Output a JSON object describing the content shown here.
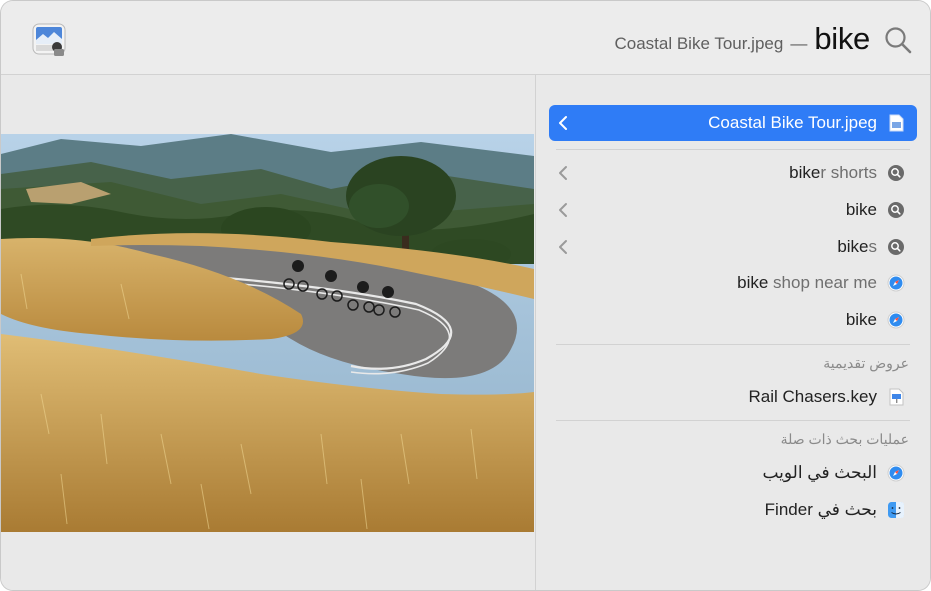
{
  "header": {
    "selected_title": "Coastal Bike Tour.jpeg",
    "dash": "—",
    "query": "bike",
    "app_icon": "preview-app-icon",
    "search_icon": "magnifying-glass-icon"
  },
  "preview": {
    "image_subject": "Coastal Bike Tour photo"
  },
  "results": {
    "top_hit": {
      "label": "Coastal Bike Tour.jpeg",
      "icon": "jpeg-document-icon"
    },
    "suggestions": [
      {
        "typed": "bike",
        "rest": "r shorts",
        "icon": "search-suggestion-icon",
        "has_chevron": true
      },
      {
        "typed": "bike",
        "rest": "",
        "icon": "search-suggestion-icon",
        "has_chevron": true
      },
      {
        "typed": "bike",
        "rest": "s",
        "icon": "search-suggestion-icon",
        "has_chevron": true
      },
      {
        "typed": "bike",
        "rest": " shop near me",
        "icon": "safari-icon",
        "has_chevron": false
      },
      {
        "typed": "bike",
        "rest": "",
        "icon": "safari-icon",
        "has_chevron": false
      }
    ],
    "presentations_title": "عروض تقديمية",
    "presentations": [
      {
        "label": "Rail Chasers.key",
        "icon": "keynote-file-icon"
      }
    ],
    "related_title": "عمليات بحث ذات صلة",
    "related": [
      {
        "label": "البحث في الويب",
        "icon": "safari-icon"
      },
      {
        "label": "بحث في Finder",
        "icon": "finder-icon"
      }
    ]
  },
  "colors": {
    "selection": "#2f7cf6",
    "window_bg": "#e9e9e9"
  }
}
